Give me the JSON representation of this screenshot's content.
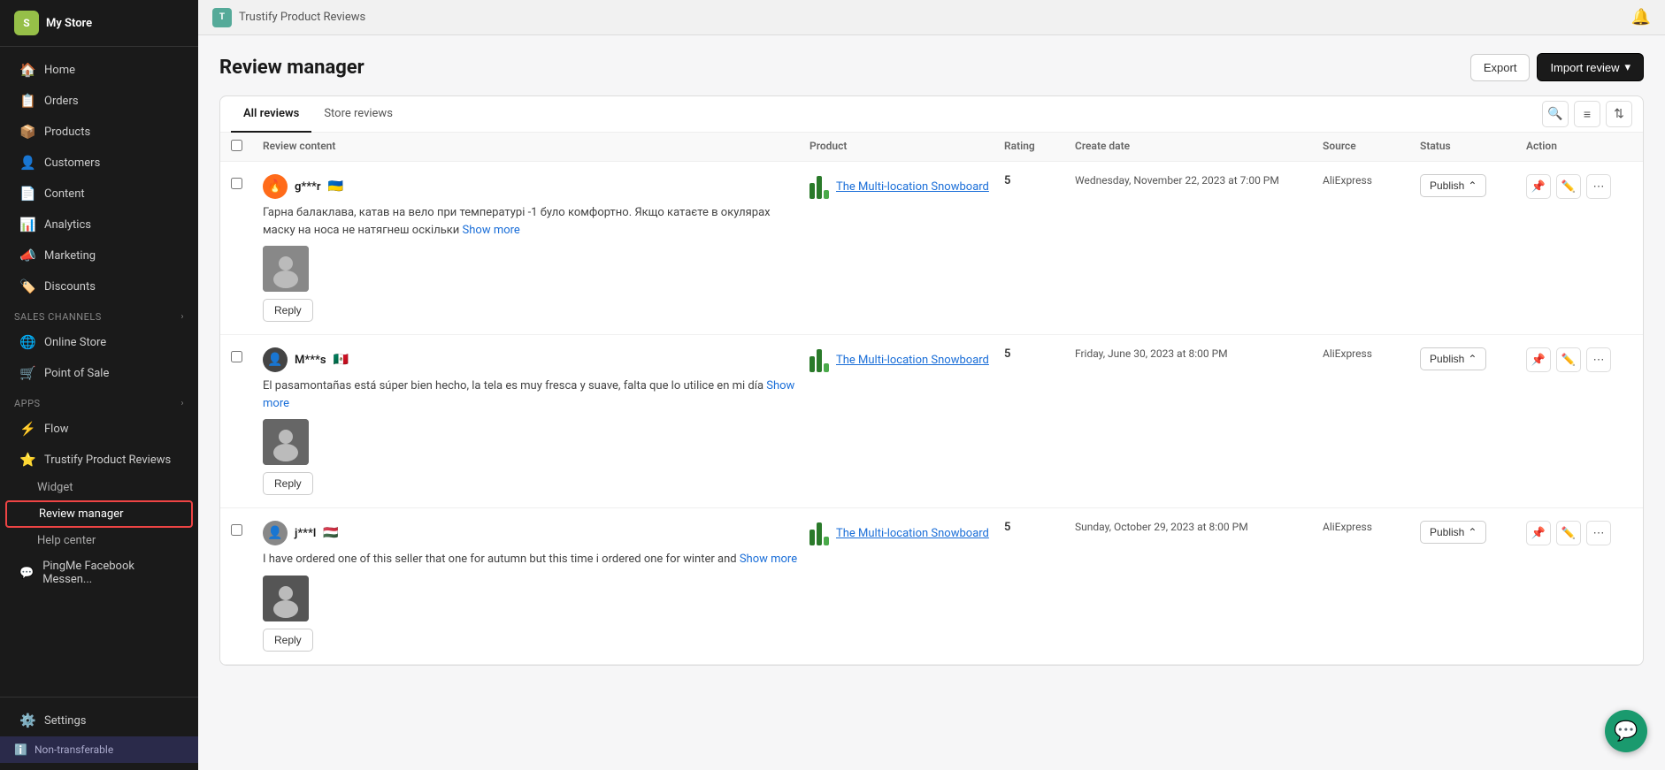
{
  "app": {
    "title": "Trustify Product Reviews",
    "topbar_title": "Trustify Product Reviews"
  },
  "sidebar": {
    "nav_items": [
      {
        "id": "home",
        "label": "Home",
        "icon": "🏠"
      },
      {
        "id": "orders",
        "label": "Orders",
        "icon": "📋"
      },
      {
        "id": "products",
        "label": "Products",
        "icon": "📦"
      },
      {
        "id": "customers",
        "label": "Customers",
        "icon": "👤"
      },
      {
        "id": "content",
        "label": "Content",
        "icon": "📄"
      },
      {
        "id": "analytics",
        "label": "Analytics",
        "icon": "📊"
      },
      {
        "id": "marketing",
        "label": "Marketing",
        "icon": "📣"
      },
      {
        "id": "discounts",
        "label": "Discounts",
        "icon": "🏷️"
      }
    ],
    "sales_channels_label": "Sales channels",
    "sales_channels": [
      {
        "id": "online-store",
        "label": "Online Store",
        "icon": "🌐"
      },
      {
        "id": "point-of-sale",
        "label": "Point of Sale",
        "icon": "🛒"
      }
    ],
    "apps_label": "Apps",
    "apps": [
      {
        "id": "flow",
        "label": "Flow",
        "icon": "⚡"
      },
      {
        "id": "trustify",
        "label": "Trustify Product Reviews",
        "icon": "⭐"
      }
    ],
    "trustify_sub": [
      {
        "id": "widget",
        "label": "Widget"
      },
      {
        "id": "review-manager",
        "label": "Review manager",
        "active": true
      },
      {
        "id": "help-center",
        "label": "Help center"
      }
    ],
    "apps2": [
      {
        "id": "pingme",
        "label": "PingMe Facebook Messen...",
        "icon": "💬"
      }
    ],
    "settings_label": "Settings",
    "settings_icon": "⚙️",
    "non_transferable_label": "Non-transferable",
    "non_transferable_icon": "ℹ️"
  },
  "page": {
    "title": "Review manager",
    "export_label": "Export",
    "import_label": "Import review",
    "import_chevron": "▾"
  },
  "tabs": [
    {
      "id": "all-reviews",
      "label": "All reviews",
      "active": true
    },
    {
      "id": "store-reviews",
      "label": "Store reviews",
      "active": false
    }
  ],
  "table": {
    "columns": [
      {
        "id": "checkbox",
        "label": ""
      },
      {
        "id": "review-content",
        "label": "Review content"
      },
      {
        "id": "product",
        "label": "Product"
      },
      {
        "id": "rating",
        "label": "Rating"
      },
      {
        "id": "create-date",
        "label": "Create date"
      },
      {
        "id": "source",
        "label": "Source"
      },
      {
        "id": "status",
        "label": "Status"
      },
      {
        "id": "action",
        "label": "Action"
      }
    ],
    "rows": [
      {
        "id": 1,
        "reviewer_name": "g***r",
        "reviewer_flag": "🇺🇦",
        "avatar_type": "orange",
        "avatar_emoji": "🔥",
        "review_text": "Гарна балаклава, катав на вело при температурі -1 було комфортно. Якщо катаєте в окулярах маску на носа не натягнеш оскільки",
        "show_more": "Show more",
        "product_name": "The Multi-location Snowboard",
        "rating": "5",
        "date": "Wednesday, November 22, 2023 at 7:00 PM",
        "source": "AliExpress",
        "status": "Publish",
        "has_thumb": true
      },
      {
        "id": 2,
        "reviewer_name": "M***s",
        "reviewer_flag": "🇲🇽",
        "avatar_type": "dark",
        "avatar_emoji": "👤",
        "review_text": "El pasamontañas está súper bien hecho, la tela es muy fresca y suave, falta que lo utilice en mi día",
        "show_more": "Show more",
        "product_name": "The Multi-location Snowboard",
        "rating": "5",
        "date": "Friday, June 30, 2023 at 8:00 PM",
        "source": "AliExpress",
        "status": "Publish",
        "has_thumb": true
      },
      {
        "id": 3,
        "reviewer_name": "j***l",
        "reviewer_flag": "🇭🇺",
        "avatar_type": "gray",
        "avatar_emoji": "👤",
        "review_text": "I have ordered one of this seller that one for autumn but this time i ordered one for winter and",
        "show_more": "Show more",
        "product_name": "The Multi-location Snowboard",
        "rating": "5",
        "date": "Sunday, October 29, 2023 at 8:00 PM",
        "source": "AliExpress",
        "status": "Publish",
        "has_thumb": true
      }
    ],
    "reply_label": "Reply",
    "publish_label": "Publish",
    "publish_chevron": "⌃"
  },
  "icons": {
    "search": "🔍",
    "filter": "≡",
    "sort": "⇅",
    "pin": "📌",
    "edit": "✏️",
    "more": "⋯",
    "bell": "🔔",
    "chat": "💬"
  }
}
